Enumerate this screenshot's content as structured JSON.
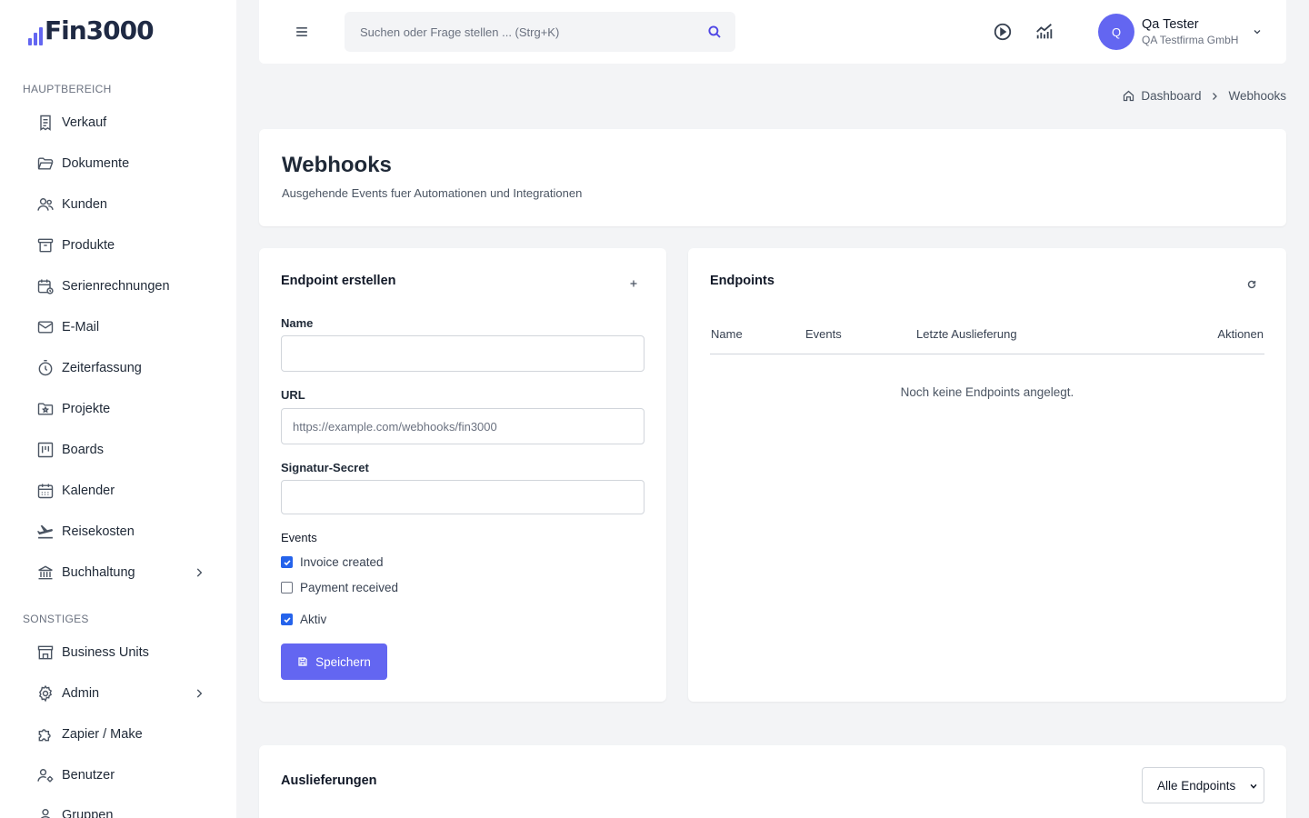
{
  "app": {
    "logo_text": "Fin3000",
    "brand_color": "#6366f1"
  },
  "sidebar": {
    "section_main": "HAUPTBEREICH",
    "section_other": "SONSTIGES",
    "items": [
      {
        "label": "Verkauf",
        "icon": "receipt-icon"
      },
      {
        "label": "Dokumente",
        "icon": "folder-open-icon"
      },
      {
        "label": "Kunden",
        "icon": "users-icon"
      },
      {
        "label": "Produkte",
        "icon": "archive-box-icon"
      },
      {
        "label": "Serienrechnungen",
        "icon": "calendar-repeat-icon"
      },
      {
        "label": "E-Mail",
        "icon": "mail-icon"
      },
      {
        "label": "Zeiterfassung",
        "icon": "stopwatch-icon"
      },
      {
        "label": "Projekte",
        "icon": "folder-star-icon"
      },
      {
        "label": "Boards",
        "icon": "kanban-icon"
      },
      {
        "label": "Kalender",
        "icon": "calendar-icon"
      },
      {
        "label": "Reisekosten",
        "icon": "plane-departure-icon"
      },
      {
        "label": "Buchhaltung",
        "icon": "bank-icon",
        "has_submenu": true
      }
    ],
    "other_items": [
      {
        "label": "Business Units",
        "icon": "store-icon"
      },
      {
        "label": "Admin",
        "icon": "gear-icon",
        "has_submenu": true
      },
      {
        "label": "Zapier / Make",
        "icon": "puzzle-icon"
      },
      {
        "label": "Benutzer",
        "icon": "user-cog-icon"
      },
      {
        "label": "Gruppen",
        "icon": "group-icon"
      }
    ]
  },
  "topbar": {
    "search_placeholder": "Suchen oder Frage stellen ... (Strg+K)",
    "user": {
      "initial": "Q",
      "name": "Qa Tester",
      "company": "QA Testfirma GmbH"
    }
  },
  "breadcrumb": {
    "home": "Dashboard",
    "current": "Webhooks"
  },
  "page": {
    "title": "Webhooks",
    "subtitle": "Ausgehende Events fuer Automationen und Integrationen"
  },
  "create_form": {
    "title": "Endpoint erstellen",
    "name_label": "Name",
    "name_value": "",
    "url_label": "URL",
    "url_placeholder": "https://example.com/webhooks/fin3000",
    "secret_label": "Signatur-Secret",
    "secret_value": "",
    "events_label": "Events",
    "events": [
      {
        "label": "Invoice created",
        "checked": true
      },
      {
        "label": "Payment received",
        "checked": false
      }
    ],
    "active_label": "Aktiv",
    "active_checked": true,
    "save_label": "Speichern"
  },
  "endpoints": {
    "title": "Endpoints",
    "columns": [
      "Name",
      "Events",
      "Letzte Auslieferung",
      "Aktionen"
    ],
    "empty_text": "Noch keine Endpoints angelegt."
  },
  "deliveries": {
    "title": "Auslieferungen",
    "filter_value": "Alle Endpoints"
  }
}
